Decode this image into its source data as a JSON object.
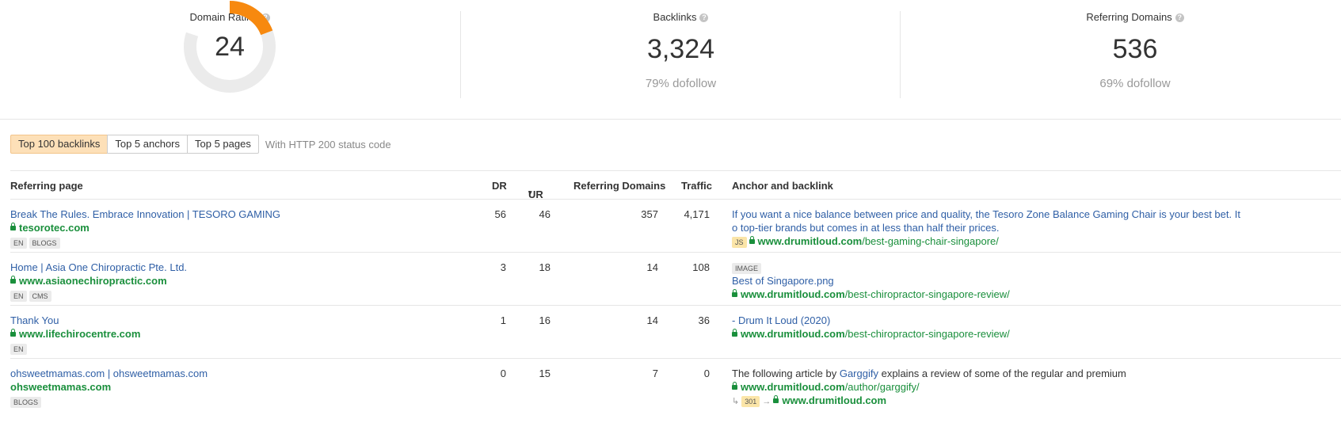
{
  "metrics": {
    "domain_rating": {
      "title": "Domain Rating",
      "value": "24",
      "fraction": 0.24
    },
    "backlinks": {
      "title": "Backlinks",
      "value": "3,324",
      "sub": "79% dofollow"
    },
    "referring_domains": {
      "title": "Referring Domains",
      "value": "536",
      "sub": "69% dofollow"
    }
  },
  "colors": {
    "accent": "#f7890f",
    "link": "#2f5fa6",
    "domain": "#1a8f3c"
  },
  "tabs": [
    "Top 100 backlinks",
    "Top 5 anchors",
    "Top 5 pages"
  ],
  "filter_note": "With HTTP 200 status code",
  "columns": {
    "page": "Referring page",
    "dr": "DR",
    "ur": "UR",
    "ur_sort": "▾",
    "rd": "Referring Domains",
    "traffic": "Traffic",
    "anchor": "Anchor and backlink"
  },
  "rows": [
    {
      "title": "Break The Rules. Embrace Innovation | TESORO GAMING",
      "domain": "tesorotec.com",
      "tags": [
        "EN",
        "BLOGS"
      ],
      "dr": "56",
      "ur": "46",
      "rd": "357",
      "traffic": "4,171",
      "anchor_line1": "If you want a nice balance between price and quality, the Tesoro Zone Balance Gaming Chair is your best bet. It",
      "anchor_line2": "o top-tier brands but comes in at less than half their prices.",
      "badge": "JS",
      "backlink_domain": "www.drumitloud.com",
      "backlink_path": "/best-gaming-chair-singapore/"
    },
    {
      "title": "Home | Asia One Chiropractic Pte. Ltd.",
      "domain": "www.asiaonechiropractic.com",
      "tags": [
        "EN",
        "CMS"
      ],
      "dr": "3",
      "ur": "18",
      "rd": "14",
      "traffic": "108",
      "badge": "IMAGE",
      "anchor_line1": "Best of Singapore.png",
      "backlink_domain": "www.drumitloud.com",
      "backlink_path": "/best-chiropractor-singapore-review/"
    },
    {
      "title": "Thank You",
      "domain": "www.lifechirocentre.com",
      "tags": [
        "EN"
      ],
      "dr": "1",
      "ur": "16",
      "rd": "14",
      "traffic": "36",
      "anchor_line1": "- Drum It Loud (2020)",
      "backlink_domain": "www.drumitloud.com",
      "backlink_path": "/best-chiropractor-singapore-review/"
    },
    {
      "title": "ohsweetmamas.com | ohsweetmamas.com",
      "domain": "ohsweetmamas.com",
      "tags": [
        "BLOGS"
      ],
      "dr": "0",
      "ur": "15",
      "rd": "7",
      "traffic": "0",
      "anchor_pre": "The following article by ",
      "anchor_link": "Garggify",
      "anchor_post": " explains a review of some of the regular and premium",
      "backlink_domain": "www.drumitloud.com",
      "backlink_path": "/author/garggify/",
      "redirect_code": "301",
      "redirect_domain": "www.drumitloud.com"
    }
  ]
}
